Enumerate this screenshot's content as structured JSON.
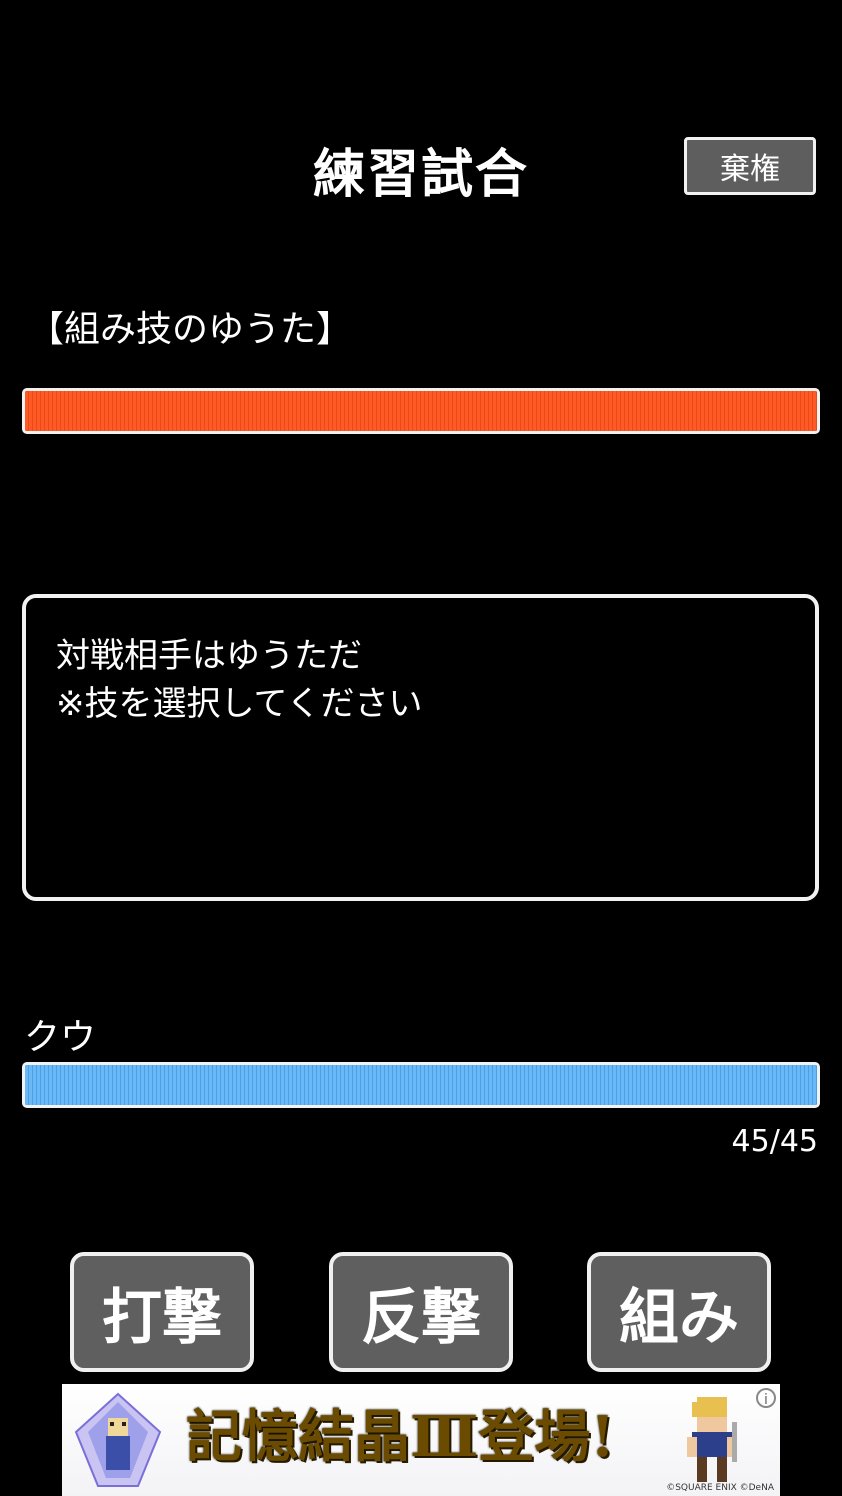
{
  "header": {
    "title": "練習試合",
    "forfeit_label": "棄権"
  },
  "enemy": {
    "name": "【組み技のゆうた】",
    "hp_fraction": 1.0,
    "bar_color": "#ff5a26"
  },
  "message": {
    "line1": "対戦相手はゆうただ",
    "line2": "※技を選択してください"
  },
  "player": {
    "name": "クウ",
    "hp_current": "45",
    "hp_separator": "/",
    "hp_max": "45",
    "hp_fraction": 1.0,
    "bar_color": "#6ab8f5"
  },
  "commands": [
    {
      "label": "打撃"
    },
    {
      "label": "反撃"
    },
    {
      "label": "組み"
    }
  ],
  "ad": {
    "headline": "記憶結晶Ⅲ登場!",
    "copyright": "©SQUARE ENIX ©DeNA",
    "info_icon": "info-icon"
  }
}
